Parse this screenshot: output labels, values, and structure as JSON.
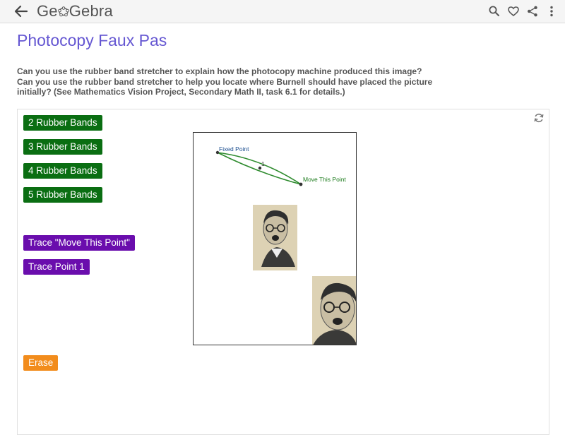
{
  "header": {
    "logo_left": "Ge",
    "logo_right": "Gebra",
    "icons": [
      "back-arrow-icon",
      "search-icon",
      "heart-icon",
      "share-icon",
      "more-vert-icon"
    ]
  },
  "page": {
    "title": "Photocopy Faux Pas",
    "description_line1": "Can you use the rubber band stretcher to explain how the photocopy machine produced this image?",
    "description_line2": "Can you use the rubber band stretcher to help you locate where Burnell should have placed the picture initially? (See Mathematics Vision Project, Secondary Math II, task 6.1 for details.)"
  },
  "applet": {
    "buttons": {
      "two_bands": "2 Rubber Bands",
      "three_bands": "3 Rubber Bands",
      "four_bands": "4 Rubber Bands",
      "five_bands": "5 Rubber Bands",
      "trace_move": "Trace \"Move This Point\"",
      "trace_point1": "Trace Point 1",
      "erase": "Erase"
    },
    "graphics": {
      "fixed_point_label": "Fixed Point",
      "point1_label": "1",
      "move_point_label": "Move This Point"
    }
  },
  "colors": {
    "title": "#6557d2",
    "green_button": "#0a6e12",
    "purple_button": "#6a0dad",
    "orange_button": "#f28c1c"
  }
}
